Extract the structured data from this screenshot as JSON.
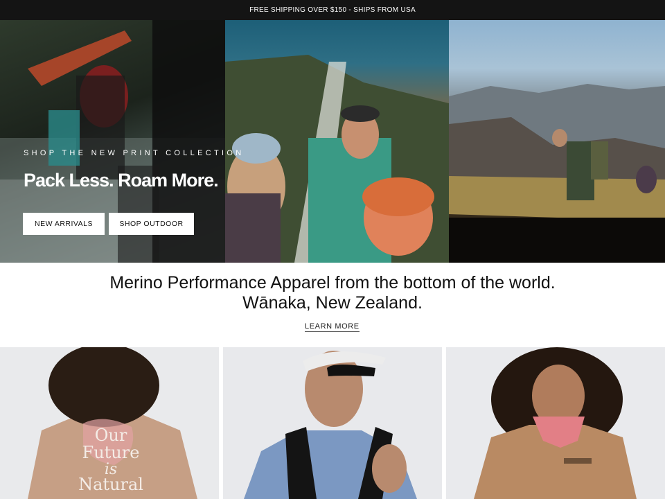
{
  "announcement": {
    "text": "FREE SHIPPING OVER $150 - SHIPS FROM USA"
  },
  "hero": {
    "eyebrow": "SHOP THE NEW PRINT COLLECTION",
    "headline": "Pack Less. Roam More.",
    "buttons": [
      {
        "label": "NEW ARRIVALS"
      },
      {
        "label": "SHOP OUTDOOR"
      }
    ],
    "images": [
      {
        "description_icon": "river-hikers-photo"
      },
      {
        "description_icon": "waterfall-selfie-photo"
      },
      {
        "description_icon": "mountain-hiker-photo"
      }
    ]
  },
  "intro": {
    "title": "Merino Performance Apparel from the bottom of the world. Wānaka, New Zealand.",
    "link": "LEARN MORE"
  },
  "products": [
    {
      "icon": "product-photo-print-tee",
      "print_text": "Our Future is Natural"
    },
    {
      "icon": "product-photo-running-vest"
    },
    {
      "icon": "product-photo-tan-tee"
    }
  ],
  "colors": {
    "announcement_bg": "#141414",
    "button_bg": "#ffffff",
    "text": "#111111"
  }
}
